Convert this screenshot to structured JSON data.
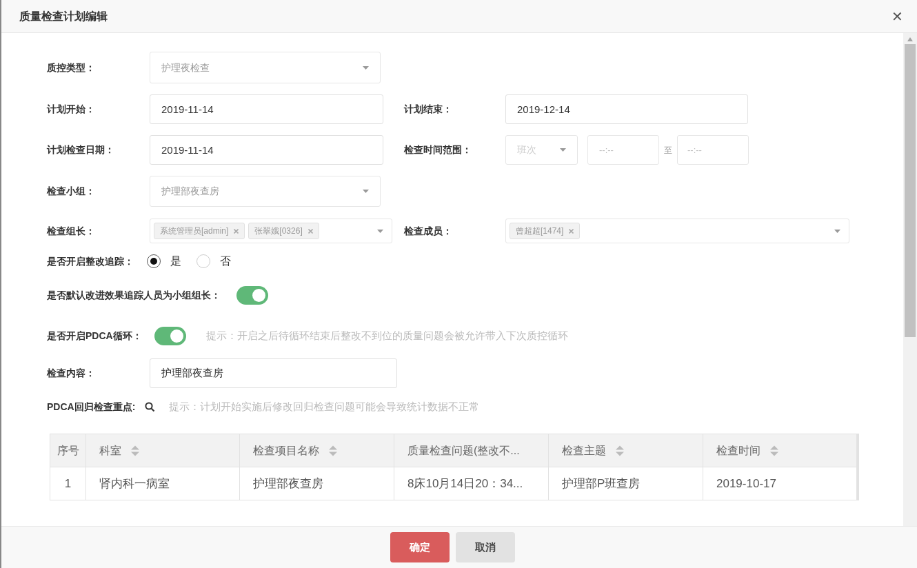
{
  "dialog": {
    "title": "质量检查计划编辑",
    "close": "✕"
  },
  "quality_type": {
    "label": "质控类型：",
    "value": "护理夜检查",
    "disabled": true
  },
  "plan_start": {
    "label": "计划开始：",
    "value": "2019-11-14"
  },
  "plan_end": {
    "label": "计划结束：",
    "value": "2019-12-14"
  },
  "check_date": {
    "label": "计划检查日期：",
    "value": "2019-11-14"
  },
  "time_range": {
    "label": "检查时间范围：",
    "shift_placeholder": "班次",
    "start_placeholder": "--:--",
    "separator": "至",
    "end_placeholder": "--:--"
  },
  "check_group": {
    "label": "检查小组：",
    "value": "护理部夜查房",
    "disabled": true
  },
  "leader": {
    "label": "检查组长：",
    "tags": [
      "系统管理员[admin]",
      "张翠娥[0326]"
    ]
  },
  "members": {
    "label": "检查成员：",
    "tags": [
      "曾超超[1474]"
    ]
  },
  "rectification_tracking": {
    "label": "是否开启整改追踪：",
    "options": [
      {
        "label": "是",
        "selected": true
      },
      {
        "label": "否",
        "selected": false
      }
    ]
  },
  "default_leader_toggle": {
    "label": "是否默认改进效果追踪人员为小组组长：",
    "on": true
  },
  "pdca_toggle": {
    "label": "是否开启PDCA循环：",
    "on": true,
    "hint": "提示：开启之后待循环结束后整改不到位的质量问题会被允许带入下次质控循环"
  },
  "check_content": {
    "label": "检查内容：",
    "value": "护理部夜查房"
  },
  "pdca_focus": {
    "label": "PDCA回归检查重点:",
    "hint": "提示：计划开始实施后修改回归检查问题可能会导致统计数据不正常"
  },
  "table": {
    "columns": [
      {
        "label": "序号",
        "sortable": false
      },
      {
        "label": "科室",
        "sortable": true
      },
      {
        "label": "检查项目名称",
        "sortable": true
      },
      {
        "label": "质量检查问题(整改不...",
        "sortable": false
      },
      {
        "label": "检查主题",
        "sortable": true
      },
      {
        "label": "检查时间",
        "sortable": true
      }
    ],
    "rows": [
      [
        "1",
        "肾内科一病室",
        "护理部夜查房",
        "8床10月14日20：34...",
        "护理部P班查房",
        "2019-10-17"
      ]
    ]
  },
  "buttons": [
    {
      "label": "确定",
      "kind": "primary"
    },
    {
      "label": "取消",
      "kind": "secondary"
    }
  ]
}
